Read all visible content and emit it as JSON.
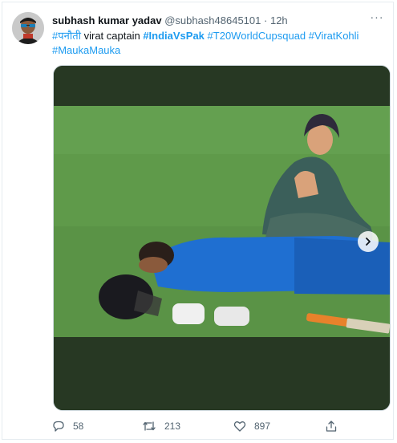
{
  "tweet": {
    "author_name": "subhash kumar yadav",
    "author_handle": "@subhash48645101",
    "separator": "·",
    "time": "12h",
    "more_label": "···",
    "text": {
      "hashtag1": "#पनौती",
      "plain": " virat captain ",
      "hashtag2": "#IndiaVsPak",
      "hashtag3": "#T20WorldCupsquad",
      "hashtag4": "#ViratKohli",
      "hashtag5": "#MaukaMauka"
    },
    "media": {
      "icons": {
        "next": "chevron-right-icon"
      }
    },
    "actions": {
      "reply_count": "58",
      "retweet_count": "213",
      "like_count": "897",
      "icons": {
        "reply": "reply-icon",
        "retweet": "retweet-icon",
        "like": "heart-icon",
        "share": "share-icon"
      }
    }
  },
  "colors": {
    "link": "#1d9bf0",
    "secondary_text": "#536471",
    "media_background": "#273823",
    "pitch_green": "#5f9a4a"
  }
}
